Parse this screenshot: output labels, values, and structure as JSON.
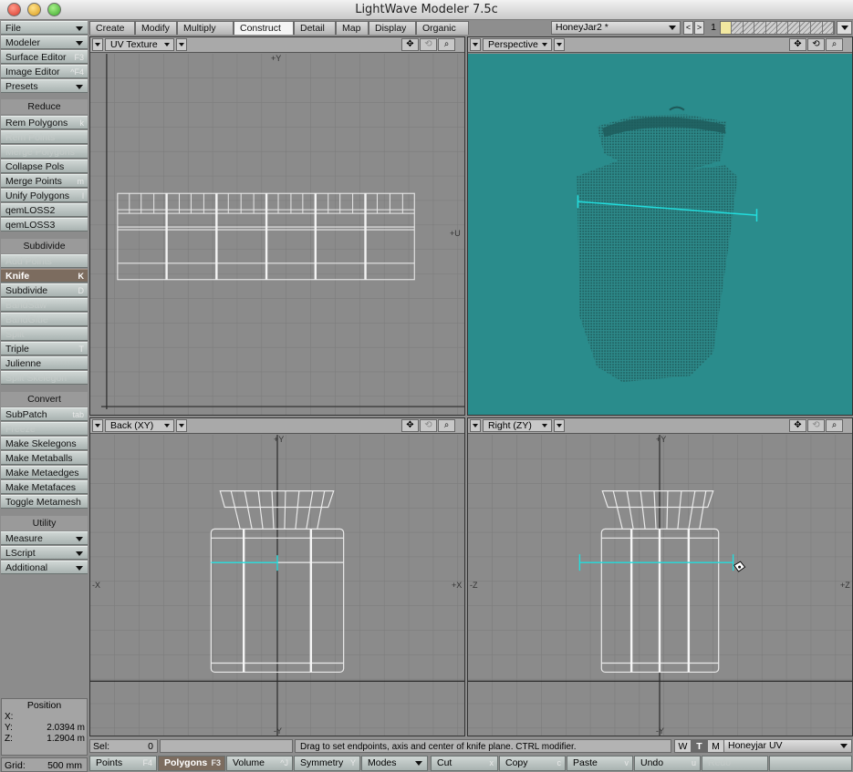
{
  "window": {
    "title": "LightWave Modeler 7.5c"
  },
  "sidebar": {
    "file": "File",
    "modeler": "Modeler",
    "surface_editor": {
      "label": "Surface Editor",
      "key": "F3"
    },
    "image_editor": {
      "label": "Image Editor",
      "key": "^F4"
    },
    "presets": "Presets",
    "reduce_header": "Reduce",
    "rem_polygons": {
      "label": "Rem Polygons",
      "key": "k"
    },
    "rem_points": "Rem Points",
    "merge_polygons": "Merge Polygons",
    "collapse_pols": "Collapse Pols",
    "merge_points": {
      "label": "Merge Points",
      "key": "m"
    },
    "unify_polygons": {
      "label": "Unify Polygons",
      "key": "l"
    },
    "qemloss2": "qemLOSS2",
    "qemloss3": "qemLOSS3",
    "subdivide_header": "Subdivide",
    "add_points": "Add Points",
    "knife": {
      "label": "Knife",
      "key": "K"
    },
    "subdivide": {
      "label": "Subdivide",
      "key": "D"
    },
    "bandsaw": "BandSaw",
    "bandglue": "BandGlue",
    "split": "Split",
    "triple": {
      "label": "Triple",
      "key": "T"
    },
    "julienne": "Julienne",
    "split_skelegon": "Split Skelegon",
    "convert_header": "Convert",
    "subpatch": {
      "label": "SubPatch",
      "key": "tab"
    },
    "freeze": "Freeze",
    "make_skelegons": "Make Skelegons",
    "make_metaballs": "Make Metaballs",
    "make_metaedges": "Make Metaedges",
    "make_metafaces": "Make Metafaces",
    "toggle_metamesh": "Toggle Metamesh",
    "utility_header": "Utility",
    "measure": "Measure",
    "lscript": "LScript",
    "additional": "Additional"
  },
  "position": {
    "title": "Position",
    "x_label": "X:",
    "x_value": "",
    "y_label": "Y:",
    "y_value": "2.0394 m",
    "z_label": "Z:",
    "z_value": "1.2904 m"
  },
  "grid": {
    "label": "Grid:",
    "value": "500 mm"
  },
  "tabs": [
    "Create",
    "Modify",
    "Multiply",
    "Construct",
    "Detail",
    "Map",
    "Display",
    "Organic"
  ],
  "active_tab": "Construct",
  "object": {
    "name": "HoneyJar2 *",
    "prev": "<",
    "next": ">",
    "layer_number": "1"
  },
  "viewports": {
    "top_left": {
      "view": "UV Texture",
      "axis_v": "+Y",
      "axis_u": "+U"
    },
    "top_right": {
      "view": "Perspective"
    },
    "bottom_left": {
      "view": "Back    (XY)",
      "axis_top": "+Y",
      "axis_bottom": "-Y",
      "axis_left": "-X",
      "axis_right": "+X"
    },
    "bottom_right": {
      "view": "Right     (ZY)",
      "axis_top": "+Y",
      "axis_bottom": "-Y",
      "axis_left": "-Z",
      "axis_right": "+Z"
    }
  },
  "status": {
    "sel_label": "Sel:",
    "sel_value": "0",
    "message": "Drag to set endpoints, axis and center of knife plane. CTRL modifier.",
    "w": "W",
    "t": "T",
    "m": "M",
    "uv_map": "Honeyjar UV"
  },
  "bottom_bar": {
    "points": {
      "label": "Points",
      "key": "F4"
    },
    "polygons": {
      "label": "Polygons",
      "key": "F3"
    },
    "volume": {
      "label": "Volume",
      "key": "^J"
    },
    "symmetry": {
      "label": "Symmetry",
      "key": "Y"
    },
    "modes": "Modes",
    "cut": {
      "label": "Cut",
      "key": "x"
    },
    "copy": {
      "label": "Copy",
      "key": "c"
    },
    "paste": {
      "label": "Paste",
      "key": "v"
    },
    "undo": {
      "label": "Undo",
      "key": "u"
    },
    "redo": "Redo"
  },
  "colors": {
    "perspective_bg": "#2a8c8c",
    "knife_line": "#22dddd",
    "active_button": "#7c6c5f"
  }
}
